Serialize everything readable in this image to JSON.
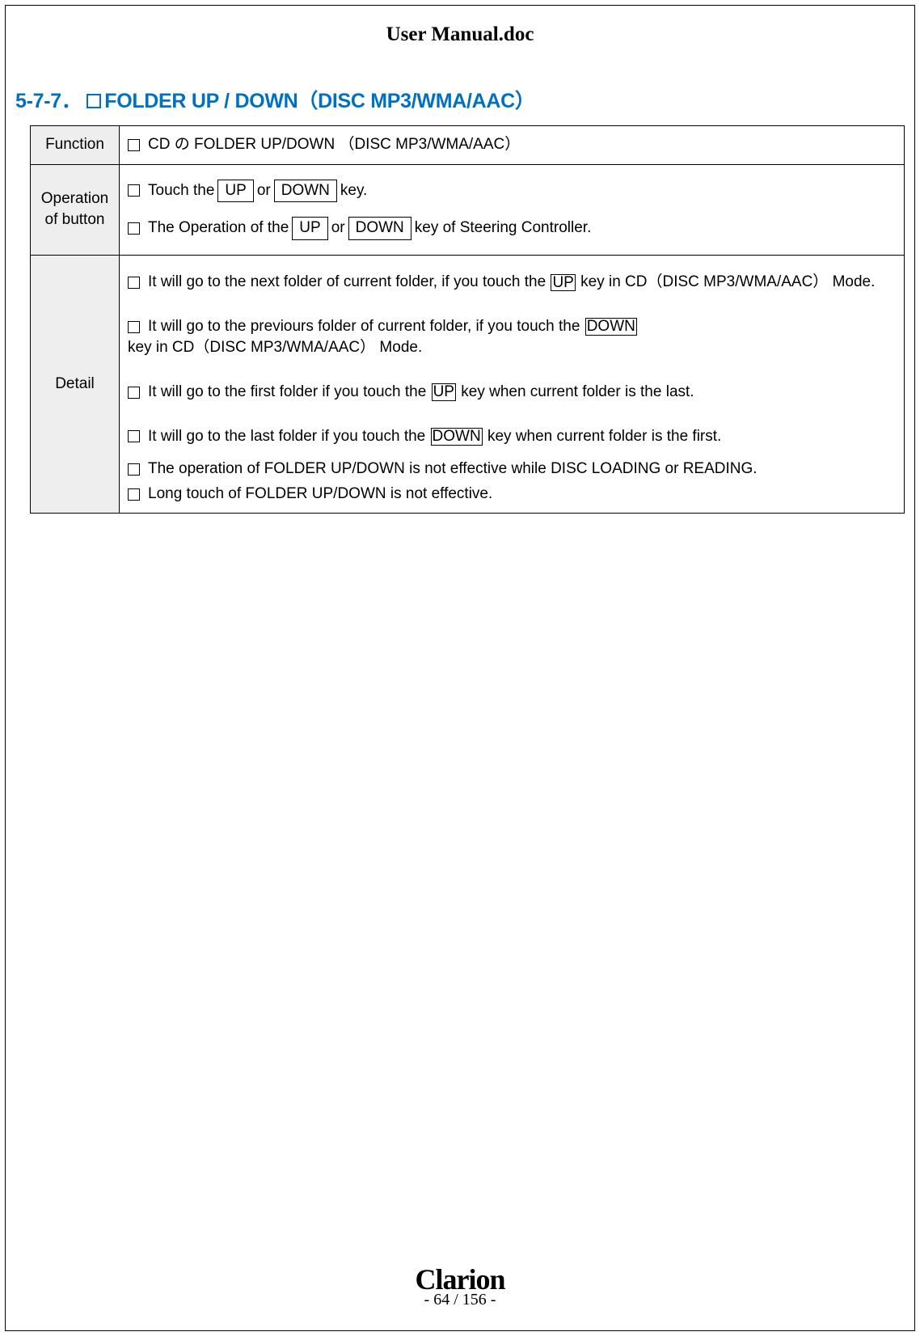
{
  "doc_title": "User Manual.doc",
  "section": {
    "number": "5-7-7．",
    "title_main": "FOLDER UP / DOWN（DISC MP3/WMA/AAC）"
  },
  "rows": {
    "function": {
      "label": "Function",
      "text": "CD の FOLDER UP/DOWN （DISC MP3/WMA/AAC）"
    },
    "operation": {
      "label": "Operation of button",
      "line1_pre": "Touch the",
      "key_up": "UP",
      "or_text": "or",
      "key_down": "DOWN",
      "line1_post": "key.",
      "line2_pre": "The Operation of the",
      "line2_post": "key of Steering Controller."
    },
    "detail": {
      "label": "Detail",
      "d1_pre": "It will go to the next folder of current folder, if you touch the",
      "d1_key": "UP",
      "d1_post": "key in CD（DISC MP3/WMA/AAC） Mode.",
      "d2_pre": "It will go to the previours folder of current folder, if you touch the",
      "d2_key": "DOWN",
      "d2_post": "key in CD（DISC MP3/WMA/AAC） Mode.",
      "d3_pre": "It will go to the first folder if you touch the",
      "d3_key": "UP",
      "d3_post": "key when current folder is the last.",
      "d4_pre": "It will go to the last folder if you touch the",
      "d4_key": "DOWN",
      "d4_post": "key when current folder is the first.",
      "d5": "The operation of FOLDER UP/DOWN is not effective while DISC LOADING or READING.",
      "d6": "Long touch of FOLDER UP/DOWN is not effective."
    }
  },
  "footer": {
    "brand": "Clarion",
    "page_current": "64",
    "page_total": "156"
  }
}
